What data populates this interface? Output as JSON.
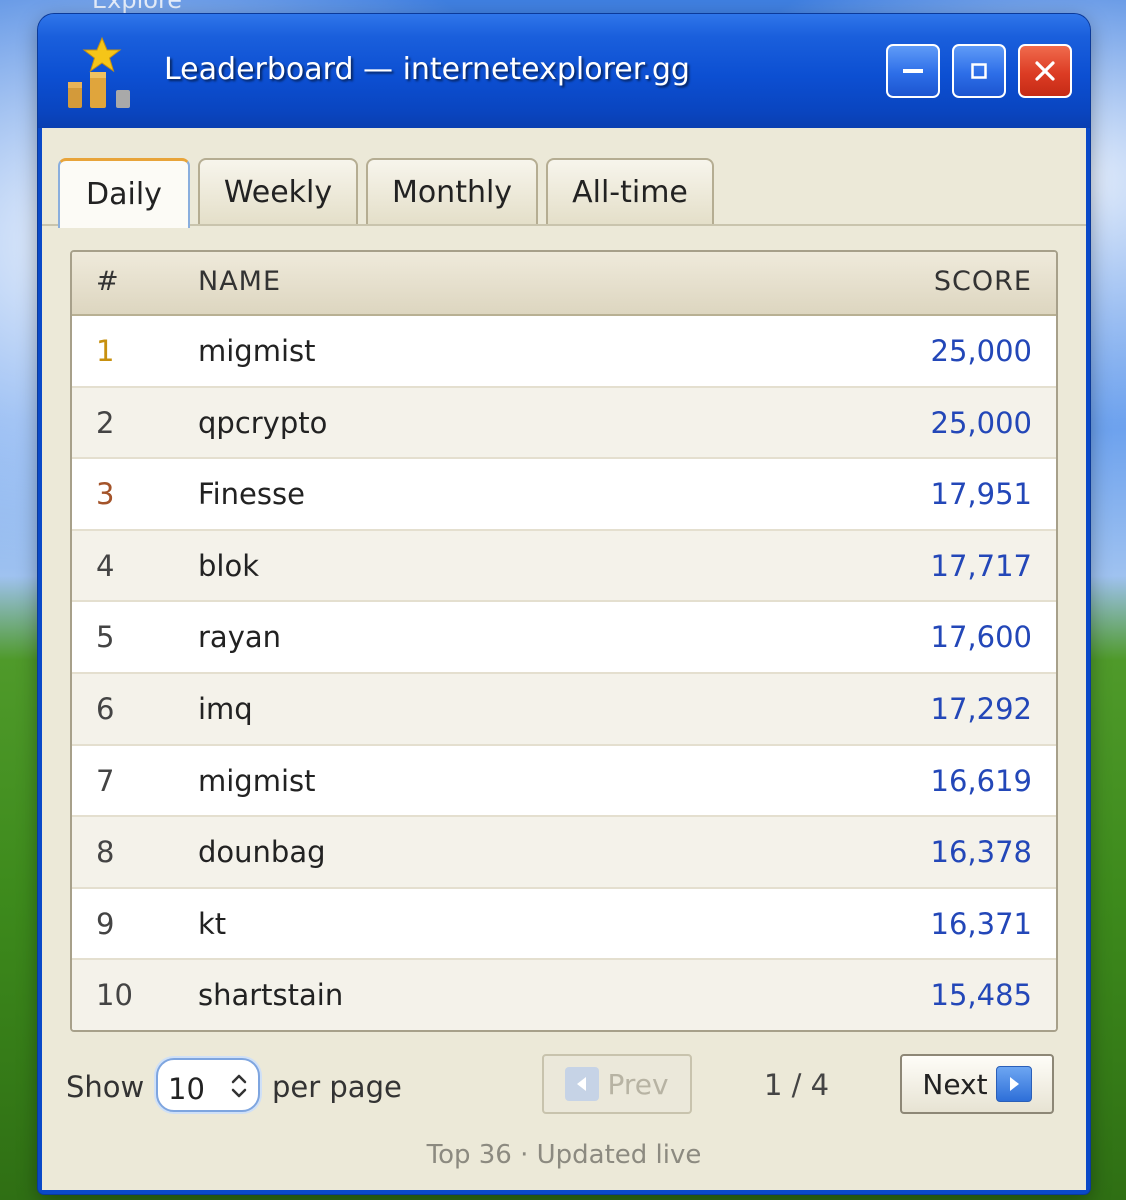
{
  "background": {
    "window_caption": "Explore"
  },
  "window": {
    "title": "Leaderboard — internetexplorer.gg",
    "controls": {
      "minimize": "minimize",
      "maximize": "maximize",
      "close": "close"
    }
  },
  "tabs": [
    {
      "label": "Daily",
      "active": true
    },
    {
      "label": "Weekly",
      "active": false
    },
    {
      "label": "Monthly",
      "active": false
    },
    {
      "label": "All-time",
      "active": false
    }
  ],
  "table": {
    "columns": {
      "rank": "#",
      "name": "NAME",
      "score": "SCORE"
    },
    "rows": [
      {
        "rank": "1",
        "name": "migmist",
        "score": "25,000"
      },
      {
        "rank": "2",
        "name": "qpcrypto",
        "score": "25,000"
      },
      {
        "rank": "3",
        "name": "Finesse",
        "score": "17,951"
      },
      {
        "rank": "4",
        "name": "blok",
        "score": "17,717"
      },
      {
        "rank": "5",
        "name": "rayan",
        "score": "17,600"
      },
      {
        "rank": "6",
        "name": "imq",
        "score": "17,292"
      },
      {
        "rank": "7",
        "name": "migmist",
        "score": "16,619"
      },
      {
        "rank": "8",
        "name": "dounbag",
        "score": "16,378"
      },
      {
        "rank": "9",
        "name": "kt",
        "score": "16,371"
      },
      {
        "rank": "10",
        "name": "shartstain",
        "score": "15,485"
      }
    ]
  },
  "footer": {
    "show_label": "Show",
    "per_page_value": "10",
    "per_page_label": "per page",
    "prev_label": "Prev",
    "page_indicator": "1 / 4",
    "next_label": "Next",
    "status": "Top 36 · Updated live"
  },
  "colors": {
    "titlebar": "#0c4fd2",
    "client_bg": "#ece9d8",
    "score_blue": "#2347b8",
    "rank_gold": "#c7900f",
    "rank_bronze": "#a4542a",
    "close_red": "#dc3c24"
  },
  "icons": {
    "app": "leaderboard-star-podium-icon",
    "minimize": "minimize-icon",
    "maximize": "maximize-icon",
    "close": "close-icon",
    "prev": "arrow-left-icon",
    "next": "arrow-right-icon",
    "select": "chevron-updown-icon"
  }
}
